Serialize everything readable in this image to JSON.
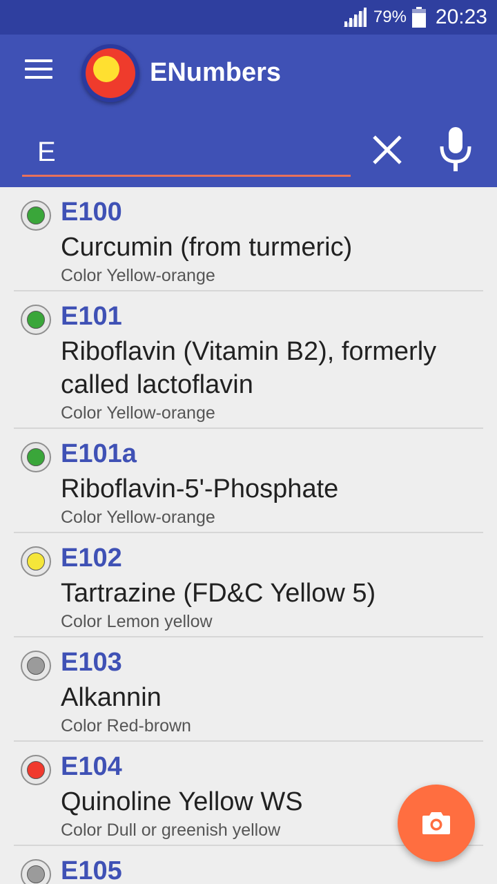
{
  "status_bar": {
    "battery_percent": "79%",
    "time": "20:23",
    "signal_icon": "signal-icon",
    "battery_icon": "battery-icon"
  },
  "app_bar": {
    "title": "ENumbers",
    "menu_icon": "hamburger-menu-icon",
    "logo_icon": "app-logo-icon"
  },
  "search": {
    "value": "E",
    "clear_icon": "close-icon",
    "voice_icon": "mic-icon"
  },
  "items": [
    {
      "code": "E100",
      "name": "Curcumin (from turmeric)",
      "category": "Color Yellow-orange",
      "status_color": "#3aa63a"
    },
    {
      "code": "E101",
      "name": "Riboflavin (Vitamin B2), formerly called lactoflavin",
      "category": "Color Yellow-orange",
      "status_color": "#3aa63a"
    },
    {
      "code": "E101a",
      "name": "Riboflavin-5'-Phosphate",
      "category": "Color Yellow-orange",
      "status_color": "#3aa63a"
    },
    {
      "code": "E102",
      "name": "Tartrazine (FD&C Yellow 5)",
      "category": "Color Lemon yellow",
      "status_color": "#f5e63a"
    },
    {
      "code": "E103",
      "name": "Alkannin",
      "category": "Color Red-brown",
      "status_color": "#9b9b9b"
    },
    {
      "code": "E104",
      "name": "Quinoline Yellow WS",
      "category": "Color Dull or greenish yellow",
      "status_color": "#f03a2e"
    },
    {
      "code": "E105",
      "name": "",
      "category": "",
      "status_color": "#9b9b9b"
    }
  ],
  "fab": {
    "icon": "camera-icon",
    "color": "#ff6e40"
  },
  "colors": {
    "primary": "#3f51b5",
    "primary_dark": "#2f3f9f",
    "accent": "#ff6e40"
  }
}
